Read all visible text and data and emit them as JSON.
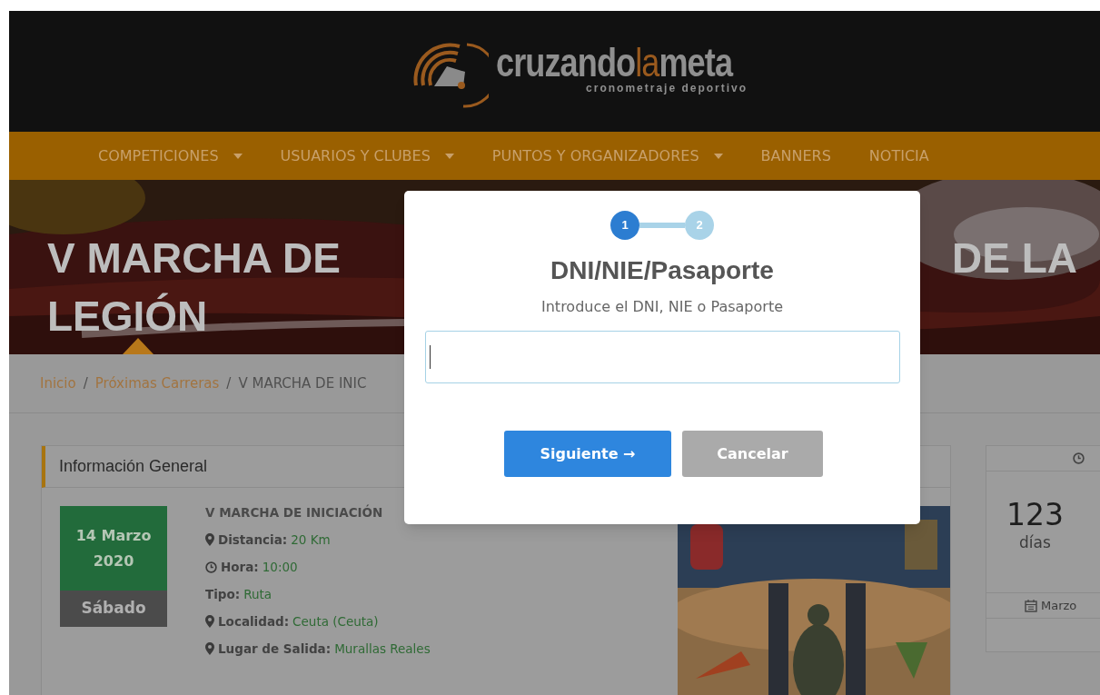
{
  "header": {
    "logo": {
      "word_1": "cruzando",
      "word_2": "la",
      "word_3": "meta",
      "tagline": "cronometraje deportivo"
    }
  },
  "nav": {
    "items": [
      {
        "label": "COMPETICIONES",
        "dropdown": true
      },
      {
        "label": "USUARIOS Y CLUBES",
        "dropdown": true
      },
      {
        "label": "PUNTOS Y ORGANIZADORES",
        "dropdown": true
      },
      {
        "label": "BANNERS",
        "dropdown": false
      },
      {
        "label": "NOTICIA",
        "dropdown": false
      }
    ]
  },
  "hero": {
    "title_line_1_left": "V MARCHA DE",
    "title_line_1_right": "DE LA",
    "title_line_2": "LEGIÓN"
  },
  "breadcrumb": [
    {
      "label": "Inicio",
      "kind": "link"
    },
    {
      "label": "/",
      "kind": "separator"
    },
    {
      "label": "Próximas Carreras",
      "kind": "link"
    },
    {
      "label": "/",
      "kind": "separator"
    },
    {
      "label": "V MARCHA DE INIC",
      "kind": "current"
    }
  ],
  "info_card": {
    "title": "Información General",
    "date": {
      "day": "14 Marzo",
      "year": "2020",
      "weekday": "Sábado"
    },
    "event_name": "V MARCHA DE INICIACIÓN",
    "details": [
      {
        "kind": "place",
        "label": "Distancia:",
        "value": "20 Km"
      },
      {
        "kind": "time",
        "label": "Hora:",
        "value": "10:00"
      },
      {
        "kind": "plain",
        "label": "Tipo:",
        "value": "Ruta"
      },
      {
        "kind": "place",
        "label": "Localidad:",
        "value": "Ceuta (Ceuta)"
      },
      {
        "kind": "place",
        "label": "Lugar de Salida:",
        "value": "Murallas Reales"
      }
    ]
  },
  "countdown": {
    "number": "123",
    "unit": "días",
    "date": "Marzo"
  },
  "modal": {
    "steps": [
      {
        "label": "1",
        "selected": true
      },
      {
        "label": "2",
        "selected": false
      }
    ],
    "title": "DNI/NIE/Pasaporte",
    "subtitle": "Introduce el DNI, NIE o Pasaporte",
    "buttons": [
      {
        "label": "Siguiente →",
        "kind": "primary"
      },
      {
        "label": "Cancelar",
        "kind": "secondary"
      }
    ]
  }
}
